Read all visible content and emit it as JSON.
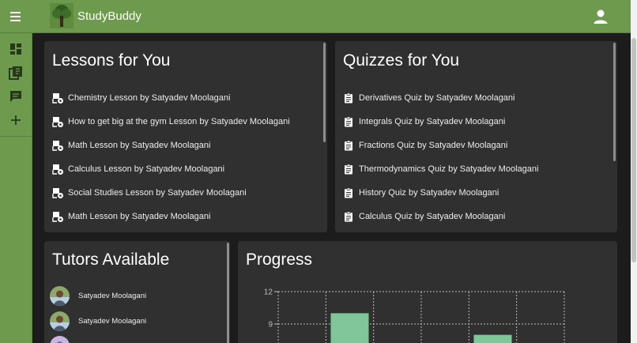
{
  "app": {
    "brand": "StudyBuddy"
  },
  "icons": {
    "menu": "menu-icon",
    "logo": "tree-logo",
    "account": "account-circle-icon",
    "sidebar": [
      "dashboard-icon",
      "library-books-icon",
      "chat-icon",
      "add-icon"
    ]
  },
  "colors": {
    "appbar": "#6d9a4c",
    "card": "#303030",
    "background": "#1c1c1c",
    "bar": "#7fc79a"
  },
  "lessons": {
    "title": "Lessons for You",
    "items": [
      "Chemistry Lesson by Satyadev Moolagani",
      "How to get big at the gym Lesson by Satyadev Moolagani",
      "Math Lesson by Satyadev Moolagani",
      "Calculus Lesson by Satyadev Moolagani",
      "Social Studies Lesson by Satyadev Moolagani",
      "Math Lesson by Satyadev Moolagani"
    ]
  },
  "quizzes": {
    "title": "Quizzes for You",
    "items": [
      "Derivatives Quiz by Satyadev Moolagani",
      "Integrals Quiz by Satyadev Moolagani",
      "Fractions Quiz by Satyadev Moolagani",
      "Thermodynamics Quiz by Satyadev Moolagani",
      "History Quiz by Satyadev Moolagani",
      "Calculus Quiz by Satyadev Moolagani"
    ]
  },
  "tutors": {
    "title": "Tutors Available",
    "items": [
      "Satyadev Moolagani",
      "Satyadev Moolagani"
    ]
  },
  "progress": {
    "title": "Progress",
    "chart_data": {
      "type": "bar",
      "yticks": [
        "12",
        "9"
      ],
      "ylim": [
        0,
        12
      ],
      "grid": true,
      "series": [
        {
          "values": [
            10,
            8
          ]
        }
      ]
    }
  }
}
